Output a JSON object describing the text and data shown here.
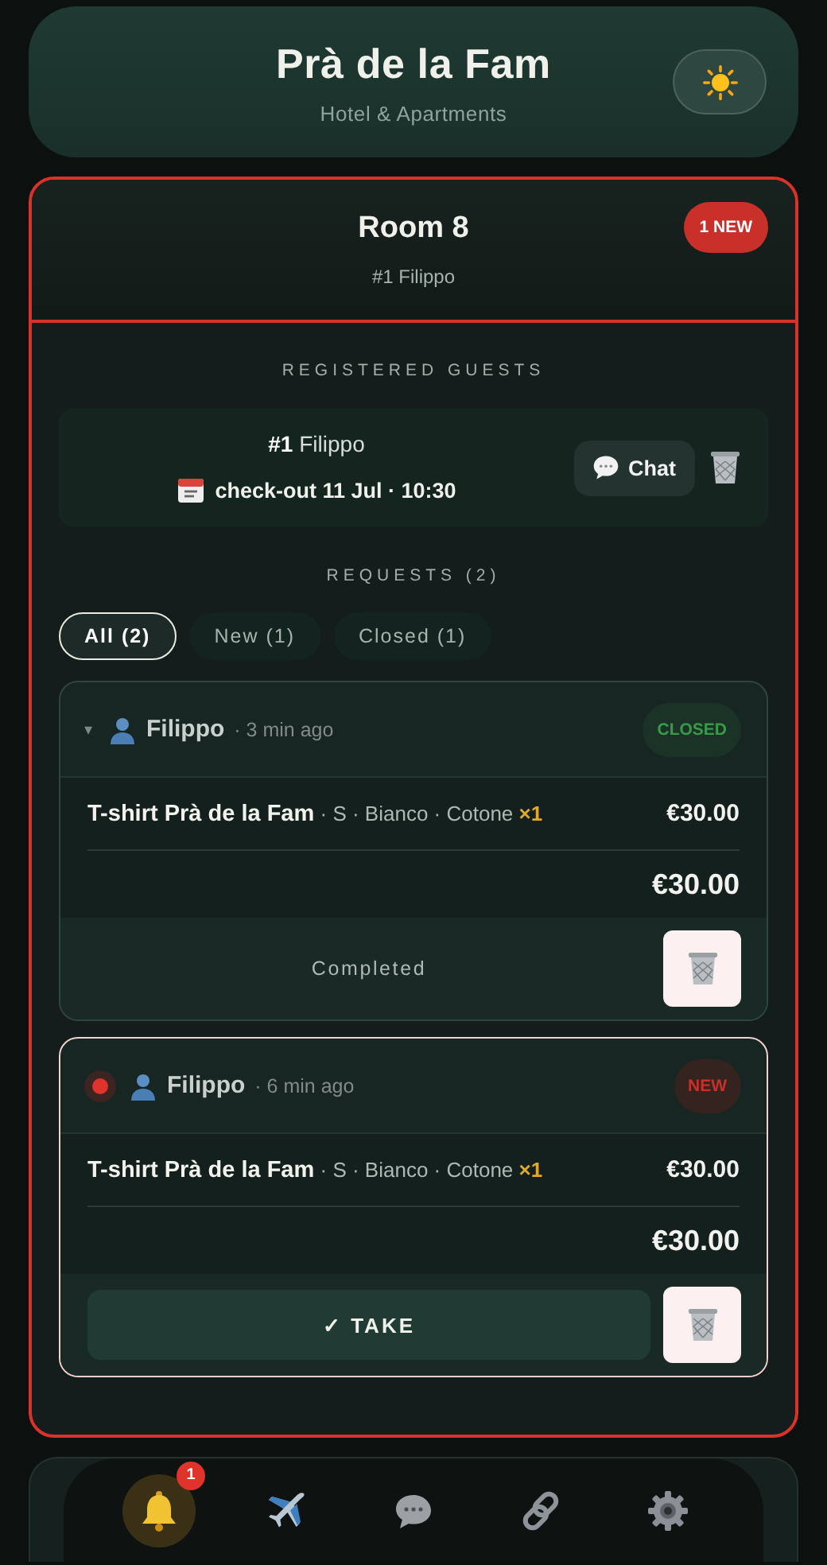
{
  "header": {
    "title": "Prà de la Fam",
    "subtitle": "Hotel & Apartments"
  },
  "room": {
    "title": "Room 8",
    "subtitle": "#1 Filippo",
    "badge": "1 NEW"
  },
  "guests": {
    "heading": "REGISTERED GUESTS",
    "items": [
      {
        "number": "#1",
        "name": "Filippo",
        "checkout": "check-out 11 Jul · 10:30",
        "chat_label": "Chat"
      }
    ]
  },
  "requests": {
    "heading": "REQUESTS (2)",
    "filters": [
      {
        "label": "All (2)",
        "selected": true
      },
      {
        "label": "New (1)",
        "selected": false
      },
      {
        "label": "Closed (1)",
        "selected": false
      }
    ],
    "items": [
      {
        "kind": "closed",
        "toggle": "▾",
        "guest": "Filippo",
        "time": "· 3 min ago",
        "status_label": "CLOSED",
        "product": "T-shirt Prà de la Fam",
        "options": "· S · Bianco · Cotone",
        "quantity": "×1",
        "price": "€30.00",
        "total": "€30.00",
        "note": "Completed"
      },
      {
        "kind": "new",
        "guest": "Filippo",
        "time": "· 6 min ago",
        "status_label": "NEW",
        "product": "T-shirt Prà de la Fam",
        "options": "· S · Bianco · Cotone",
        "quantity": "×1",
        "price": "€30.00",
        "total": "€30.00",
        "action": "✓ TAKE"
      }
    ]
  },
  "nav": [
    {
      "kind": "bell",
      "selected": true,
      "badge": "1"
    },
    {
      "kind": "plane",
      "selected": false
    },
    {
      "kind": "chat",
      "selected": false
    },
    {
      "kind": "link",
      "selected": false
    },
    {
      "kind": "gear",
      "selected": false
    }
  ]
}
